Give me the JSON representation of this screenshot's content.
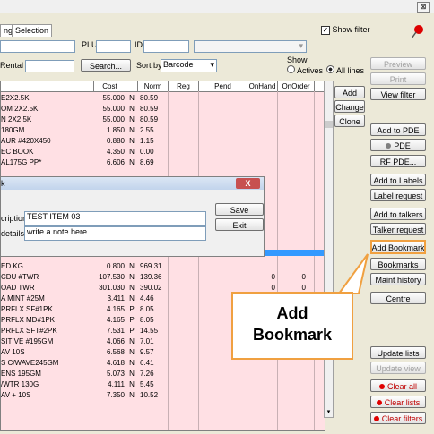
{
  "window": {
    "close_glyph": "⊠"
  },
  "tabs": [
    "ng",
    "Selection"
  ],
  "show_filter": {
    "label": "Show filter",
    "checked": true
  },
  "filters": {
    "plu_label": "PLU",
    "id_label": "ID",
    "rental_label": "Rental",
    "search_button": "Search...",
    "sort_label": "Sort by",
    "sort_value": "Barcode",
    "show_label": "Show",
    "actives_label": "Actives",
    "all_lines_label": "All lines"
  },
  "grid": {
    "columns": [
      "",
      "Cost",
      "",
      "Norm",
      "Reg",
      "Pend",
      "OnHand",
      "OnOrder"
    ],
    "rows": [
      {
        "name": "E2X2.5K",
        "cost": "55.000",
        "flag": "N",
        "norm": "80.59",
        "onhand": "",
        "onorder": ""
      },
      {
        "name": "OM  2X2.5K",
        "cost": "55.000",
        "flag": "N",
        "norm": "80.59",
        "onhand": "",
        "onorder": ""
      },
      {
        "name": "N  2X2.5K",
        "cost": "55.000",
        "flag": "N",
        "norm": "80.59",
        "onhand": "",
        "onorder": ""
      },
      {
        "name": "180GM",
        "cost": "1.850",
        "flag": "N",
        "norm": "2.55",
        "onhand": "",
        "onorder": ""
      },
      {
        "name": "AUR #420X450",
        "cost": "0.880",
        "flag": "N",
        "norm": "1.15",
        "onhand": "",
        "onorder": ""
      },
      {
        "name": "EC BOOK",
        "cost": "4.350",
        "flag": "N",
        "norm": "0.00",
        "onhand": "",
        "onorder": ""
      },
      {
        "name": "AL175G PP*",
        "cost": "6.606",
        "flag": "N",
        "norm": "8.69",
        "onhand": "",
        "onorder": ""
      },
      {
        "name": "ED KG",
        "cost": "0.800",
        "flag": "N",
        "norm": "969.31",
        "onhand": "",
        "onorder": ""
      },
      {
        "name": "CDU    #TWR",
        "cost": "107.530",
        "flag": "N",
        "norm": "139.36",
        "onhand": "0",
        "onorder": "0"
      },
      {
        "name": "OAD      TWR",
        "cost": "301.030",
        "flag": "N",
        "norm": "390.02",
        "onhand": "0",
        "onorder": "0"
      },
      {
        "name": "A MINT   #25M",
        "cost": "3.411",
        "flag": "N",
        "norm": "4.46",
        "onhand": "",
        "onorder": ""
      },
      {
        "name": "PRFLX SF#1PK",
        "cost": "4.165",
        "flag": "P",
        "norm": "8.05",
        "onhand": "",
        "onorder": ""
      },
      {
        "name": "PRFLX MD#1PK",
        "cost": "4.165",
        "flag": "P",
        "norm": "8.05",
        "onhand": "",
        "onorder": ""
      },
      {
        "name": "PRFLX SFT#2PK",
        "cost": "7.531",
        "flag": "P",
        "norm": "14.55",
        "onhand": "",
        "onorder": ""
      },
      {
        "name": "SITIVE #195GM",
        "cost": "4.066",
        "flag": "N",
        "norm": "7.01",
        "onhand": "",
        "onorder": ""
      },
      {
        "name": "AV     10S",
        "cost": "6.568",
        "flag": "N",
        "norm": "9.57",
        "onhand": "",
        "onorder": ""
      },
      {
        "name": "S C/WAVE245GM",
        "cost": "4.618",
        "flag": "N",
        "norm": "6.41",
        "onhand": "",
        "onorder": ""
      },
      {
        "name": "ENS    195GM",
        "cost": "5.073",
        "flag": "N",
        "norm": "7.26",
        "onhand": "",
        "onorder": ""
      },
      {
        "name": "/WTR 130G",
        "cost": "4.111",
        "flag": "N",
        "norm": "5.45",
        "onhand": "",
        "onorder": ""
      },
      {
        "name": "AV +   10S",
        "cost": "7.350",
        "flag": "N",
        "norm": "10.52",
        "onhand": "",
        "onorder": ""
      }
    ]
  },
  "grid_actions": [
    "Add",
    "Change",
    "Clone"
  ],
  "dialog": {
    "title": "k",
    "close_glyph": "X",
    "description_label": "cription",
    "description_value": "TEST ITEM 03",
    "details_label": "details",
    "details_value": "write a note here",
    "save_button": "Save",
    "exit_button": "Exit"
  },
  "right_panel": {
    "preview": "Preview",
    "print": "Print",
    "view_filter": "View filter",
    "add_to_pde": "Add to PDE",
    "pde": "PDE",
    "rf_pde": "RF PDE...",
    "add_to_labels": "Add to Labels",
    "label_request": "Label request",
    "add_to_talkers": "Add to talkers",
    "talker_request": "Talker request",
    "add_bookmark": "Add Bookmark",
    "bookmarks": "Bookmarks",
    "maint_history": "Maint history",
    "centre": "Centre",
    "update_lists": "Update lists",
    "update_view": "Update view",
    "clear_all": "Clear all",
    "clear_lists": "Clear lists",
    "clear_filters": "Clear filters"
  },
  "callout": {
    "line1": "Add",
    "line2": "Bookmark"
  },
  "colors": {
    "grid_bg": "#ffe0e4",
    "highlight": "#f0a040",
    "clear_red": "#e00000"
  }
}
